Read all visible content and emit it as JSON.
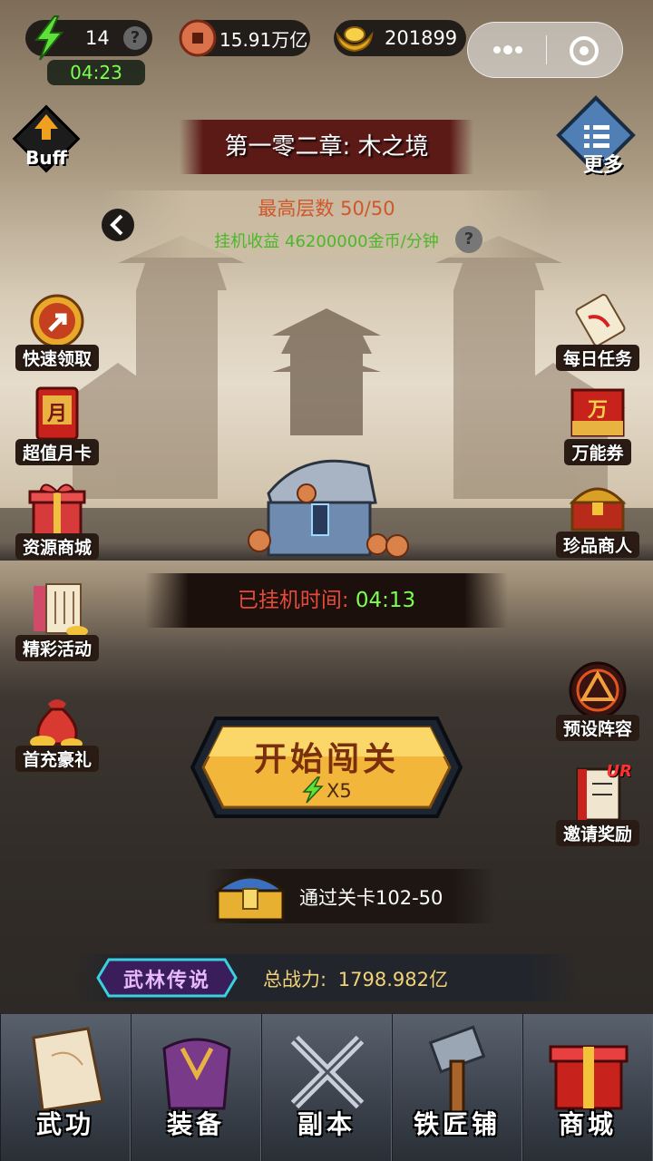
{
  "topbar": {
    "energy_value": "14",
    "energy_help_icon": "?",
    "energy_timer": "04:23",
    "coins_value": "15.91万亿",
    "gold_value": "201899",
    "icons": {
      "energy": "lightning-icon",
      "coins": "copper-coin-icon",
      "gold": "gold-ingot-icon"
    }
  },
  "capsule": {
    "more_icon": "more-dots-icon",
    "close_icon": "target-circle-icon"
  },
  "buff": {
    "label": "Buff"
  },
  "more": {
    "label": "更多"
  },
  "chapter": {
    "title": "第一零二章: 木之境"
  },
  "stage": {
    "max_floor_label": "最高层数",
    "max_floor_value": "50/50",
    "idle_income_label": "挂机收益",
    "idle_income_value": "46200000金币/分钟",
    "help_icon": "?"
  },
  "left_menu": [
    {
      "label": "快速领取",
      "icon": "quick-claim-icon"
    },
    {
      "label": "超值月卡",
      "icon": "monthly-card-icon",
      "glyph": "月"
    },
    {
      "label": "资源商城",
      "icon": "gift-box-icon"
    },
    {
      "label": "精彩活动",
      "icon": "scroll-events-icon"
    },
    {
      "label": "首充豪礼",
      "icon": "money-bag-icon"
    }
  ],
  "right_menu": [
    {
      "label": "每日任务",
      "icon": "daily-scroll-icon"
    },
    {
      "label": "万能券",
      "icon": "universal-ticket-icon",
      "glyph": "万"
    },
    {
      "label": "珍品商人",
      "icon": "treasure-chest-icon"
    },
    {
      "label": "预设阵容",
      "icon": "formation-icon"
    },
    {
      "label": "邀请奖励",
      "icon": "invite-reward-icon",
      "badge": "UR"
    }
  ],
  "idle": {
    "time_label": "已挂机时间:",
    "time_value": "04:13"
  },
  "start_button": {
    "label": "开始闯关",
    "cost": "X5"
  },
  "reward": {
    "text": "通过关卡102-50"
  },
  "power": {
    "badge": "武林传说",
    "label": "总战力:",
    "value": "1798.982亿"
  },
  "bottom_nav": [
    {
      "label": "武功",
      "icon": "martial-scroll-icon"
    },
    {
      "label": "装备",
      "icon": "armor-icon"
    },
    {
      "label": "副本",
      "icon": "crossed-swords-icon"
    },
    {
      "label": "铁匠铺",
      "icon": "hammer-icon"
    },
    {
      "label": "商城",
      "icon": "shop-gift-icon"
    }
  ],
  "colors": {
    "accent_gold": "#f2c23a",
    "income_green": "#7dff4f",
    "floor_orange": "#e8702a",
    "power_gold": "#f3d37a"
  }
}
